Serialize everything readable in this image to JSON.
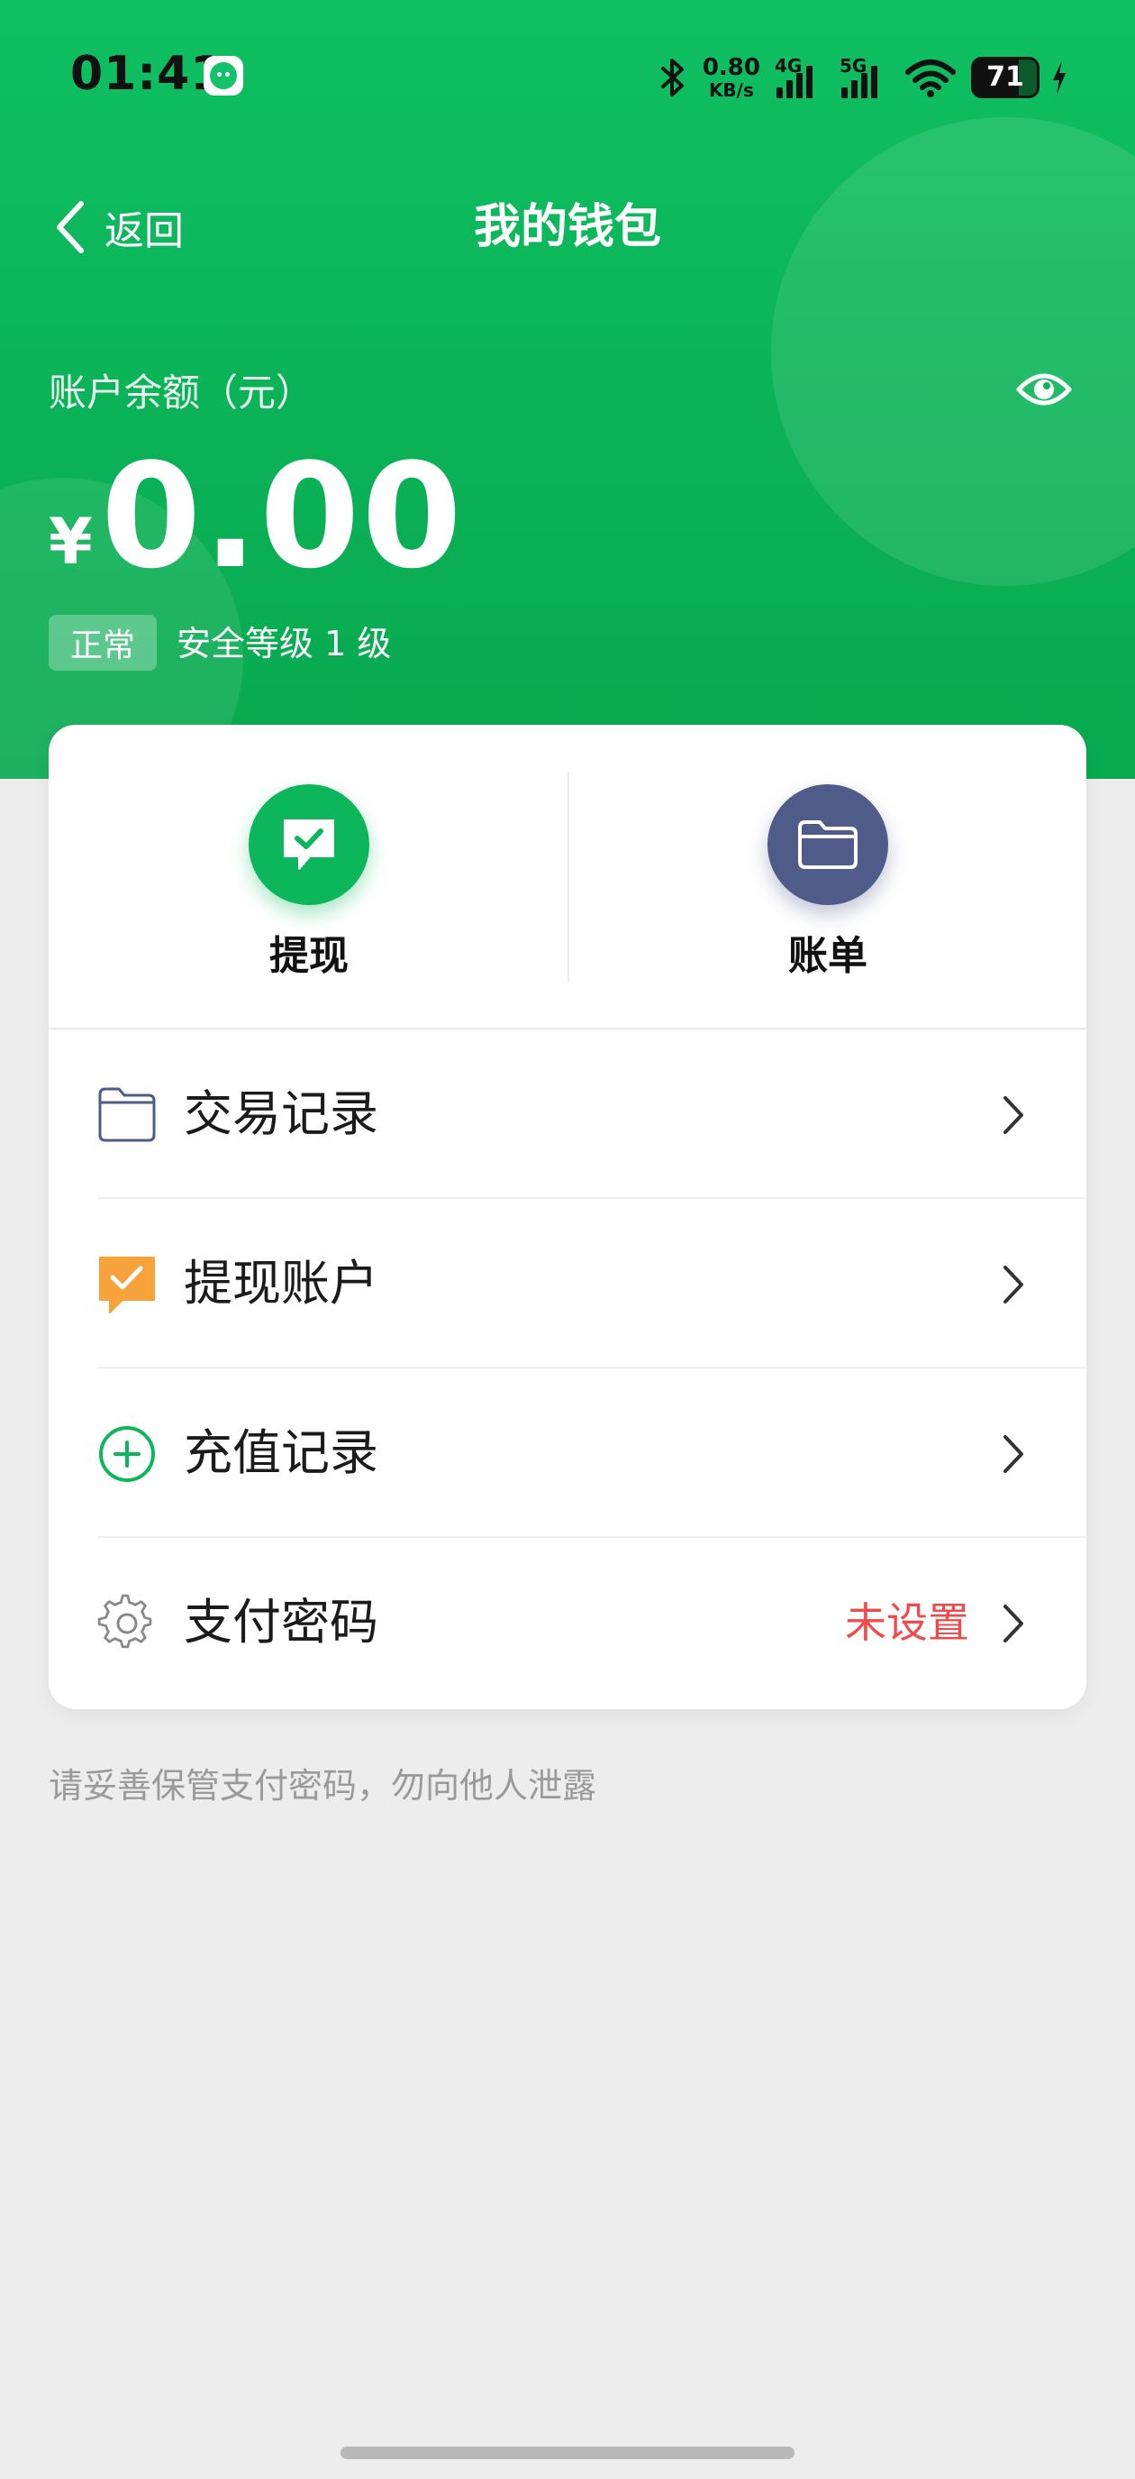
{
  "status_bar": {
    "time": "01:41",
    "net_speed_value": "0.80",
    "net_speed_unit": "KB/s",
    "signal_1_label": "4G",
    "signal_2_label": "5G",
    "battery_level": "71",
    "battery_percent": 71
  },
  "nav": {
    "back_label": "返回",
    "title": "我的钱包"
  },
  "balance": {
    "label": "账户余额（元）",
    "currency_symbol": "¥",
    "amount": "0.00",
    "status_badge": "正常",
    "security_level": "安全等级 1 级"
  },
  "quick_actions": [
    {
      "label": "提现",
      "icon": "withdraw-check-icon"
    },
    {
      "label": "账单",
      "icon": "folder-icon"
    }
  ],
  "menu": [
    {
      "label": "交易记录",
      "icon": "folder-outline-icon",
      "value": ""
    },
    {
      "label": "提现账户",
      "icon": "orange-check-icon",
      "value": ""
    },
    {
      "label": "充值记录",
      "icon": "plus-circle-icon",
      "value": ""
    },
    {
      "label": "支付密码",
      "icon": "gear-icon",
      "value": "未设置"
    }
  ],
  "hint": "请妥善保管支付密码，勿向他人泄露",
  "colors": {
    "brand_green": "#0cb65b",
    "navy": "#4f5c8a",
    "warning_red": "#f04b4b",
    "orange": "#f7a23b"
  }
}
